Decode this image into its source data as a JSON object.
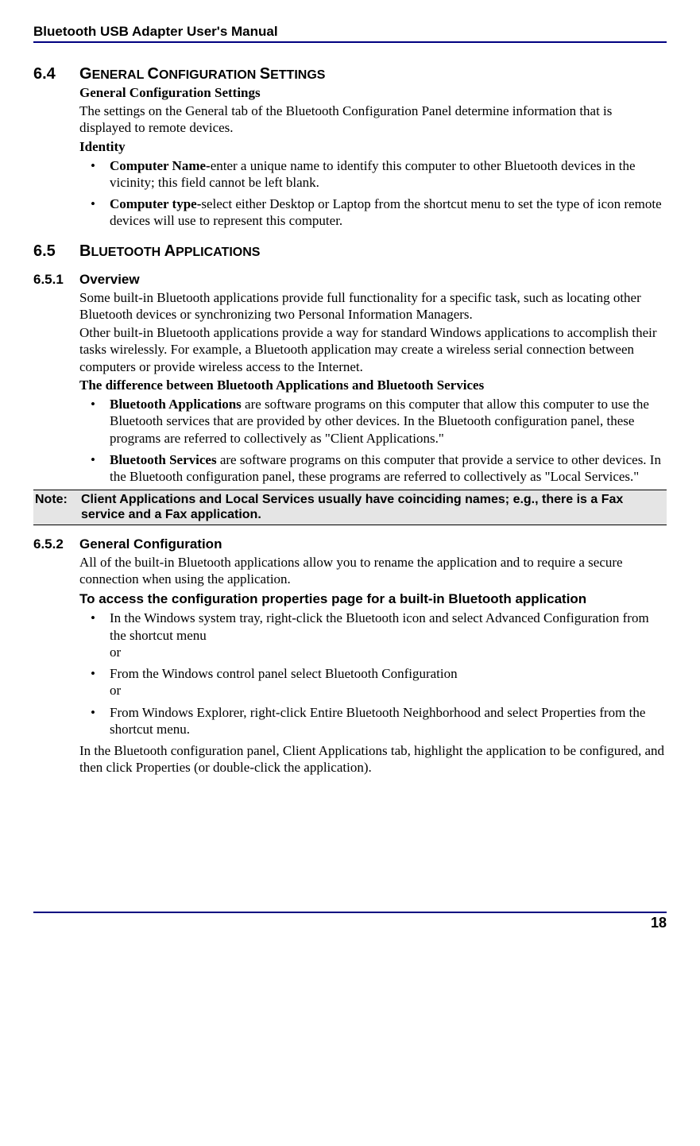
{
  "header": "Bluetooth USB Adapter User's Manual",
  "sec64": {
    "num": "6.4",
    "title_main": "G",
    "title_rest": "ENERAL ",
    "title_c": "C",
    "title_conf": "ONFIGURATION ",
    "title_s": "S",
    "title_set": "ETTINGS",
    "subtitle": "General Configuration Settings",
    "para": "The settings on the General tab of the Bluetooth Configuration Panel determine information that is displayed to remote devices.",
    "identity": "Identity",
    "b1_bold": "Computer Name-",
    "b1_rest": "enter a unique name to identify this computer to other Bluetooth devices in the vicinity; this field cannot be left blank.",
    "b2_bold": "Computer type-",
    "b2_rest": "select either Desktop or Laptop from the shortcut menu to set the type of icon remote devices will use to represent this computer."
  },
  "sec65": {
    "num": "6.5",
    "title_b": "B",
    "title_lue": "LUETOOTH ",
    "title_a": "A",
    "title_pp": "PPLICATIONS"
  },
  "sec651": {
    "num": "6.5.1",
    "title": "Overview",
    "p1": "Some built-in Bluetooth applications provide full functionality for a specific task, such as locating other Bluetooth devices or synchronizing two Personal Information Managers.",
    "p2": "Other built-in Bluetooth applications provide a way for standard Windows applications to accomplish their tasks wirelessly. For example, a Bluetooth application may create a wireless serial connection between computers or provide wireless access to the Internet.",
    "diff": "The difference between Bluetooth Applications and Bluetooth Services",
    "b1_bold": "Bluetooth Applications",
    "b1_rest": " are software programs on this computer that allow this computer to use the Bluetooth services that are provided by other devices. In the Bluetooth configuration panel, these programs are referred to collectively as \"Client Applications.\"",
    "b2_bold": "Bluetooth Services",
    "b2_rest": " are software programs on this computer that provide a service to other devices. In the Bluetooth configuration panel, these programs are referred to collectively as \"Local Services.\""
  },
  "note": {
    "label": "Note:",
    "body": "Client Applications and Local Services usually have coinciding names; e.g., there is a Fax service and a Fax application."
  },
  "sec652": {
    "num": "6.5.2",
    "title": "General Configuration",
    "p1": "All of the built-in Bluetooth applications allow you to rename the application and to require a secure connection when using the application.",
    "access": "To access the configuration properties page for a built-in Bluetooth application",
    "b1": "In the Windows system tray, right-click the Bluetooth icon and select Advanced Configuration from the shortcut menu",
    "or": "or",
    "b2": "From the Windows control panel select Bluetooth Configuration",
    "b3": "From Windows Explorer, right-click Entire Bluetooth Neighborhood and select Properties from the shortcut menu.",
    "p2": "In the Bluetooth configuration panel, Client Applications tab, highlight the application to be configured, and then click Properties (or double-click the application)."
  },
  "pagenum": "18"
}
